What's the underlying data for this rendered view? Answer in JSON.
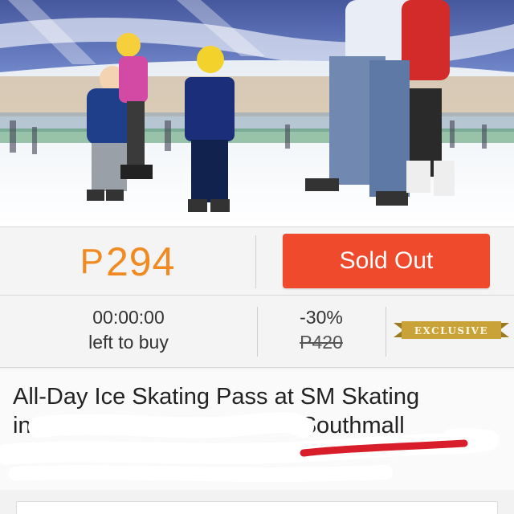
{
  "price": {
    "currency": "P",
    "amount": "294"
  },
  "buy_button": {
    "label": "Sold Out"
  },
  "timer": {
    "time": "00:00:00",
    "caption": "left to buy"
  },
  "discount": {
    "percent": "-30%",
    "original_price": "P420"
  },
  "badge": {
    "label": "EXCLUSIVE"
  },
  "deal": {
    "title_line1": "All-Day Ice Skating Pass at SM Skating",
    "title_line2_start": "in",
    "title_line2_end": "Southmall"
  },
  "colors": {
    "price": "#f08a21",
    "button": "#ef4a2c",
    "underline": "#d81e2a",
    "badge": "#c9a23a"
  }
}
